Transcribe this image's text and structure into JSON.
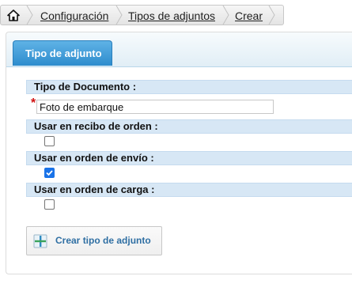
{
  "breadcrumb": {
    "home_icon": "home-icon",
    "items": [
      {
        "label": "Configuración"
      },
      {
        "label": "Tipos de adjuntos"
      },
      {
        "label": "Crear"
      }
    ]
  },
  "tab": {
    "label": "Tipo de adjunto"
  },
  "form": {
    "document_type": {
      "label": "Tipo de Documento :",
      "required_marker": "*",
      "value": "Foto de embarque"
    },
    "use_order_receipt": {
      "label": "Usar en recibo de orden :",
      "checked": false
    },
    "use_shipping_order": {
      "label": "Usar en orden de envío :",
      "checked": true
    },
    "use_load_order": {
      "label": "Usar en orden de carga :",
      "checked": false
    }
  },
  "create_button": {
    "label": "Crear tipo de adjunto",
    "icon": "add-icon"
  },
  "colors": {
    "tab_blue": "#2d8ccd",
    "header_blue": "#d7e7f5",
    "link_blue": "#2f6fa3",
    "required_red": "#d01010",
    "checkbox_blue": "#1a73e8"
  }
}
